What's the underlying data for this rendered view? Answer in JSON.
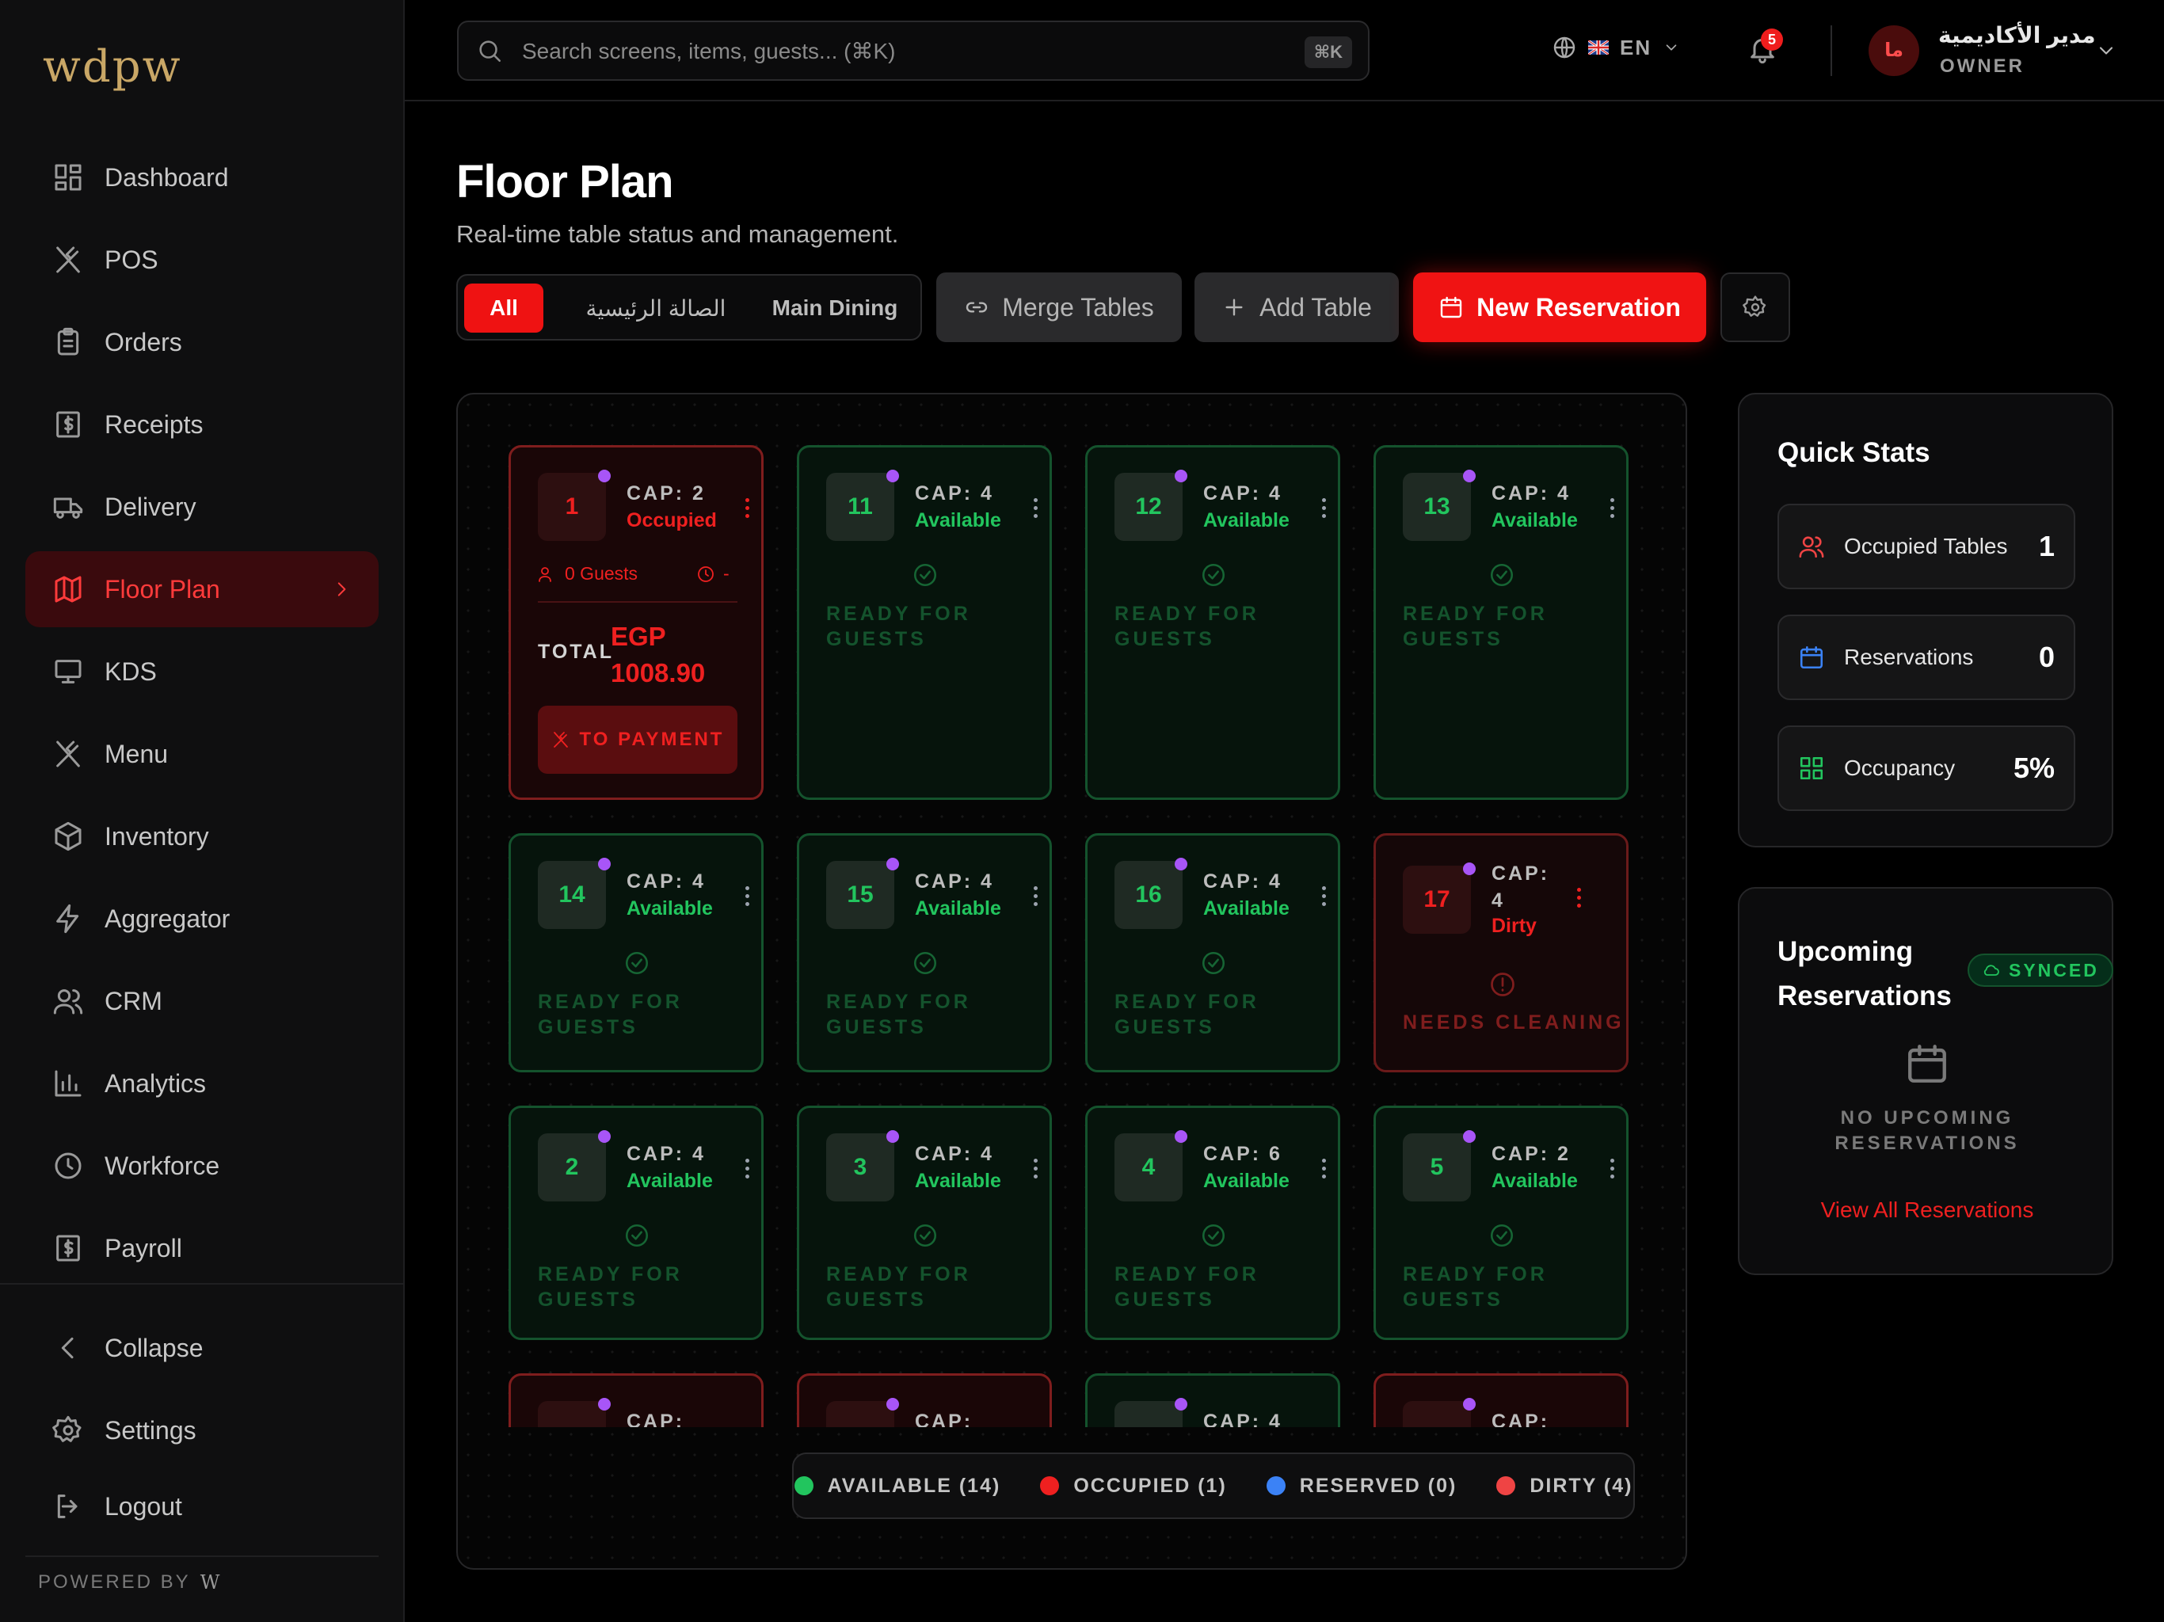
{
  "brand": {
    "logo_text": "wdpw",
    "powered_by": "POWERED BY",
    "powered_logo": "W"
  },
  "sidebar": {
    "items": [
      {
        "label": "Dashboard",
        "icon": "dashboard-icon"
      },
      {
        "label": "POS",
        "icon": "utensils-icon"
      },
      {
        "label": "Orders",
        "icon": "clipboard-icon"
      },
      {
        "label": "Receipts",
        "icon": "receipt-icon"
      },
      {
        "label": "Delivery",
        "icon": "truck-icon"
      },
      {
        "label": "Floor Plan",
        "icon": "map-icon",
        "active": true
      },
      {
        "label": "KDS",
        "icon": "monitor-icon"
      },
      {
        "label": "Menu",
        "icon": "utensils-icon"
      },
      {
        "label": "Inventory",
        "icon": "package-icon"
      },
      {
        "label": "Aggregator",
        "icon": "zap-icon"
      },
      {
        "label": "CRM",
        "icon": "users-icon"
      },
      {
        "label": "Analytics",
        "icon": "bar-chart-icon"
      },
      {
        "label": "Workforce",
        "icon": "clock-icon"
      },
      {
        "label": "Payroll",
        "icon": "dollar-icon"
      }
    ],
    "collapse": "Collapse",
    "settings": "Settings",
    "logout": "Logout"
  },
  "header": {
    "search_placeholder": "Search screens, items, guests... (⌘K)",
    "search_shortcut": "⌘K",
    "language": "EN",
    "notifications_count": "5",
    "user_name": "مدير الأكاديمية",
    "user_role": "OWNER",
    "avatar_initials": "ما"
  },
  "page": {
    "title": "Floor Plan",
    "subtitle": "Real-time table status and management."
  },
  "toolbar": {
    "filters": [
      "All",
      "الصالة الرئيسية",
      "Main Dining"
    ],
    "active_filter": "All",
    "merge": "Merge Tables",
    "add": "Add Table",
    "new_reservation": "New Reservation"
  },
  "tables": [
    {
      "num": "1",
      "cap": "CAP: 2",
      "status": "Occupied",
      "guests": "0 Guests",
      "time": "-",
      "total_label": "TOTAL",
      "currency": "EGP",
      "amount": "1008.90",
      "action": "TO PAYMENT"
    },
    {
      "num": "11",
      "cap": "CAP: 4",
      "status": "Available",
      "note": "READY FOR GUESTS"
    },
    {
      "num": "12",
      "cap": "CAP: 4",
      "status": "Available",
      "note": "READY FOR GUESTS"
    },
    {
      "num": "13",
      "cap": "CAP: 4",
      "status": "Available",
      "note": "READY FOR GUESTS"
    },
    {
      "num": "14",
      "cap": "CAP: 4",
      "status": "Available",
      "note": "READY FOR GUESTS"
    },
    {
      "num": "15",
      "cap": "CAP: 4",
      "status": "Available",
      "note": "READY FOR GUESTS"
    },
    {
      "num": "16",
      "cap": "CAP: 4",
      "status": "Available",
      "note": "READY FOR GUESTS"
    },
    {
      "num": "17",
      "cap_a": "CAP:",
      "cap_b": "4",
      "status": "Dirty",
      "note": "NEEDS CLEANING"
    },
    {
      "num": "2",
      "cap": "CAP: 4",
      "status": "Available",
      "note": "READY FOR GUESTS"
    },
    {
      "num": "3",
      "cap": "CAP: 4",
      "status": "Available",
      "note": "READY FOR GUESTS"
    },
    {
      "num": "4",
      "cap": "CAP: 6",
      "status": "Available",
      "note": "READY FOR GUESTS"
    },
    {
      "num": "5",
      "cap": "CAP: 2",
      "status": "Available",
      "note": "READY FOR GUESTS"
    },
    {
      "cap": "CAP:"
    },
    {
      "cap": "CAP:"
    },
    {
      "cap": "CAP: 4"
    },
    {
      "cap": "CAP:"
    }
  ],
  "legend": {
    "available": "AVAILABLE (14)",
    "occupied": "OCCUPIED (1)",
    "reserved": "RESERVED (0)",
    "dirty": "DIRTY (4)"
  },
  "quick_stats": {
    "title": "Quick Stats",
    "rows": [
      {
        "label": "Occupied Tables",
        "value": "1",
        "icon": "users-icon"
      },
      {
        "label": "Reservations",
        "value": "0",
        "icon": "calendar-icon"
      },
      {
        "label": "Occupancy",
        "value": "5%",
        "icon": "grid-icon"
      }
    ]
  },
  "upcoming": {
    "title": "Upcoming Reservations",
    "synced": "SYNCED",
    "empty": "NO UPCOMING RESERVATIONS",
    "view_all": "View All Reservations"
  },
  "colors": {
    "accent": "#ef1212",
    "available": "#22c55e",
    "occupied": "#ef2020",
    "reserved": "#3b82f6",
    "dot": "#a855f7"
  }
}
